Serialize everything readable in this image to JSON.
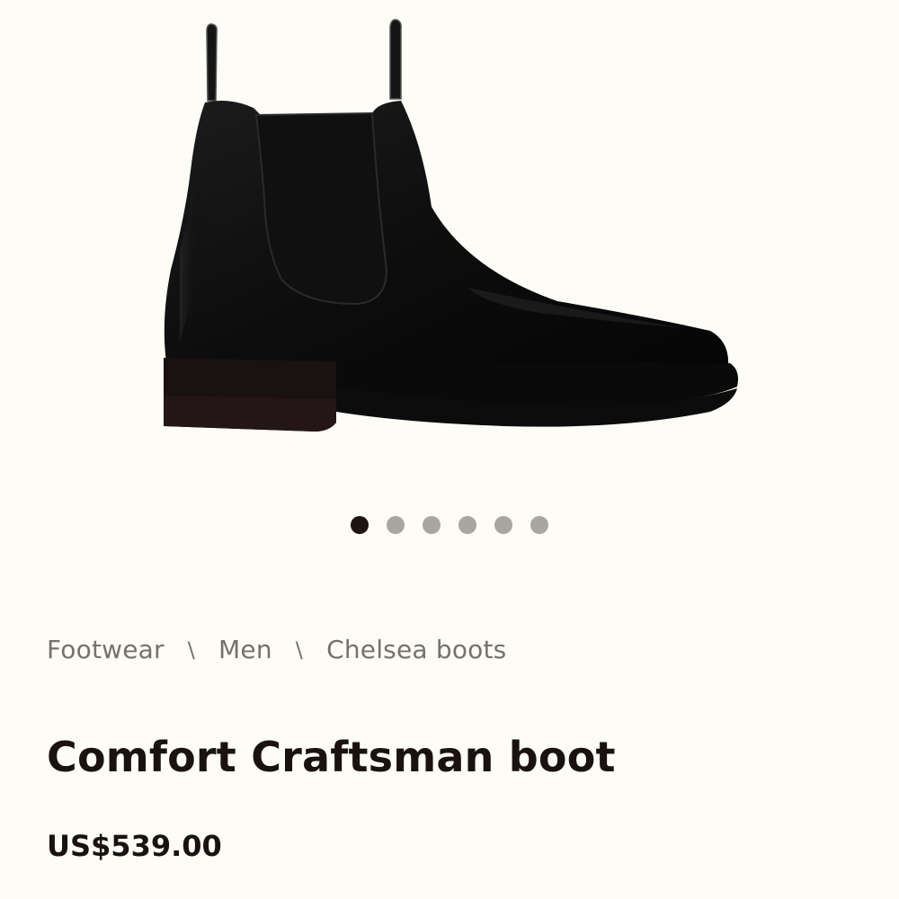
{
  "product": {
    "image_alt": "Comfort Craftsman boot",
    "title": "Comfort Craftsman boot",
    "price": "US$539.00"
  },
  "gallery": {
    "total_slides": 6,
    "active_slide": 1
  },
  "breadcrumb": {
    "items": [
      "Footwear",
      "Men",
      "Chelsea boots"
    ],
    "separator": "\\"
  },
  "colors": {
    "background": "#fdfcf6",
    "text_primary": "#1a1210",
    "text_secondary": "#77716c",
    "dot_active": "#1e1512",
    "dot_inactive": "#a9a5a1"
  }
}
